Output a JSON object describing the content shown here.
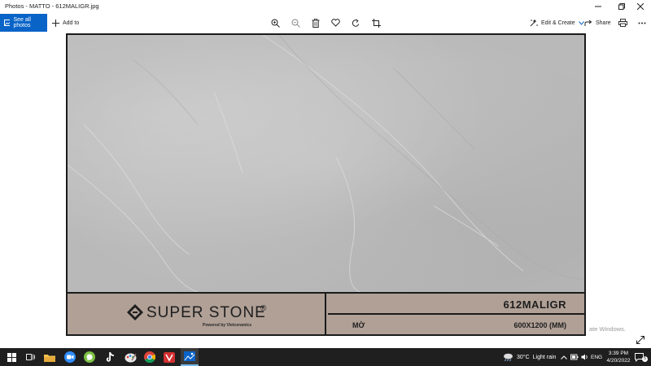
{
  "window": {
    "title": "Photos - MATTO - 612MALIGR.jpg"
  },
  "toolbar": {
    "see_all_label": "See all photos",
    "add_to_label": "Add to",
    "edit_create_label": "Edit & Create",
    "share_label": "Share"
  },
  "photo": {
    "brand_name": "SUPER STONE",
    "brand_mark": "®",
    "brand_tagline": "Powered by Vietceramics",
    "product_code": "612MALIGR",
    "finish": "MỜ",
    "size": "600X1200 (MM)"
  },
  "overlay": {
    "activate_windows": "ate Windows."
  },
  "taskbar": {
    "weather_temp": "30°C",
    "weather_desc": "Light rain",
    "language": "ENG",
    "time": "3:39 PM",
    "date": "4/20/2022",
    "notification_count": "5"
  },
  "colors": {
    "accent": "#0a64c8",
    "label_panel": "#b0a096",
    "stone": "#c4c4c4",
    "taskbar": "#1f1f1f"
  }
}
